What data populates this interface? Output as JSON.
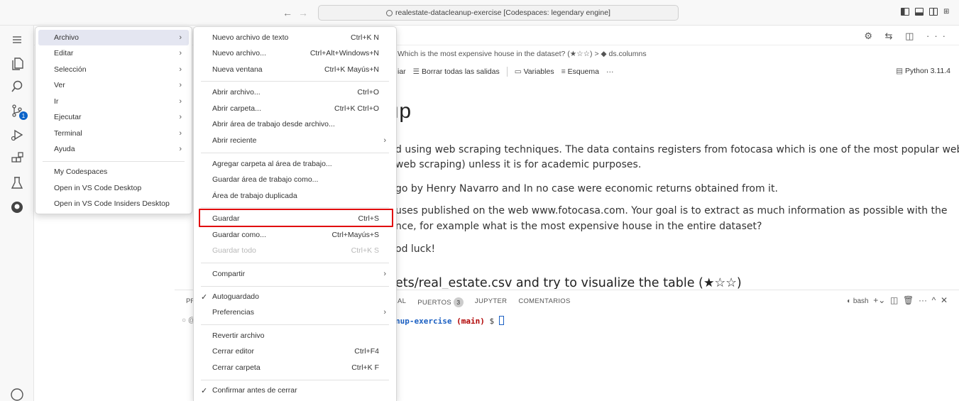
{
  "titlebar": {
    "command_center": "realestate-datacleanup-exercise [Codespaces: legendary engine]"
  },
  "activity": {
    "source_control_badge": "1"
  },
  "editor": {
    "breadcrumb": "Which is the most expensive house in the dataset? (★☆☆)  >  ◆ ds.columns",
    "toolbar": {
      "run_all_tail": "iar",
      "clear_outputs": "Borrar todas las salidas",
      "variables": "Variables",
      "outline": "Esquema",
      "more": "···"
    },
    "kernel": "Python 3.11.4",
    "heading_tail": "ıp",
    "md_lines": [
      "d using web scraping techniques. The data contains registers from fotocasa which is one of the most popular websites of",
      "web scraping) unless it is for academic purposes.",
      "go by Henry Navarro and In no case were economic returns obtained from it.",
      "uses published on the web www.fotocasa.com. Your goal is to extract as much information as possible with the",
      "nce, for example what is the most expensive house in the entire dataset?",
      "od luck!"
    ],
    "md_heading2": "ets/real_estate.csv and try to visualize the table (★☆☆)"
  },
  "panel": {
    "left_label": "PR",
    "tabs": [
      {
        "label": "AL"
      },
      {
        "label": "PUERTOS",
        "count": "3"
      },
      {
        "label": "JUPYTER"
      },
      {
        "label": "COMENTARIOS"
      }
    ],
    "terminal_name": "bash",
    "prompt_prefix": "○ @",
    "terminal_path": "nup-exercise",
    "terminal_branch": "(main)",
    "terminal_dollar": "$"
  },
  "menu_main": {
    "items": [
      {
        "label": "Archivo",
        "submenu": true
      },
      {
        "label": "Editar",
        "submenu": true
      },
      {
        "label": "Selección",
        "submenu": true
      },
      {
        "label": "Ver",
        "submenu": true
      },
      {
        "label": "Ir",
        "submenu": true
      },
      {
        "label": "Ejecutar",
        "submenu": true
      },
      {
        "label": "Terminal",
        "submenu": true
      },
      {
        "label": "Ayuda",
        "submenu": true
      },
      {
        "label": "My Codespaces"
      },
      {
        "label": "Open in VS Code Desktop"
      },
      {
        "label": "Open in VS Code Insiders Desktop"
      }
    ]
  },
  "menu_file": {
    "items": [
      {
        "label": "Nuevo archivo de texto",
        "shortcut": "Ctrl+K N"
      },
      {
        "label": "Nuevo archivo...",
        "shortcut": "Ctrl+Alt+Windows+N"
      },
      {
        "label": "Nueva ventana",
        "shortcut": "Ctrl+K Mayús+N"
      },
      {
        "label": "Abrir archivo...",
        "shortcut": "Ctrl+O"
      },
      {
        "label": "Abrir carpeta...",
        "shortcut": "Ctrl+K Ctrl+O"
      },
      {
        "label": "Abrir área de trabajo desde archivo..."
      },
      {
        "label": "Abrir reciente"
      },
      {
        "label": "Agregar carpeta al área de trabajo..."
      },
      {
        "label": "Guardar área de trabajo como..."
      },
      {
        "label": "Área de trabajo duplicada"
      },
      {
        "label": "Guardar",
        "shortcut": "Ctrl+S"
      },
      {
        "label": "Guardar como...",
        "shortcut": "Ctrl+Mayús+S"
      },
      {
        "label": "Guardar todo",
        "shortcut": "Ctrl+K S"
      },
      {
        "label": "Compartir"
      },
      {
        "label": "Autoguardado"
      },
      {
        "label": "Preferencias"
      },
      {
        "label": "Revertir archivo"
      },
      {
        "label": "Cerrar editor",
        "shortcut": "Ctrl+F4"
      },
      {
        "label": "Cerrar carpeta",
        "shortcut": "Ctrl+K F"
      },
      {
        "label": "Confirmar antes de cerrar"
      }
    ]
  },
  "colors": {
    "highlight_box": "#e1050a",
    "menu_active_bg": "#e4e6f1",
    "badge": "#0a63c9"
  }
}
